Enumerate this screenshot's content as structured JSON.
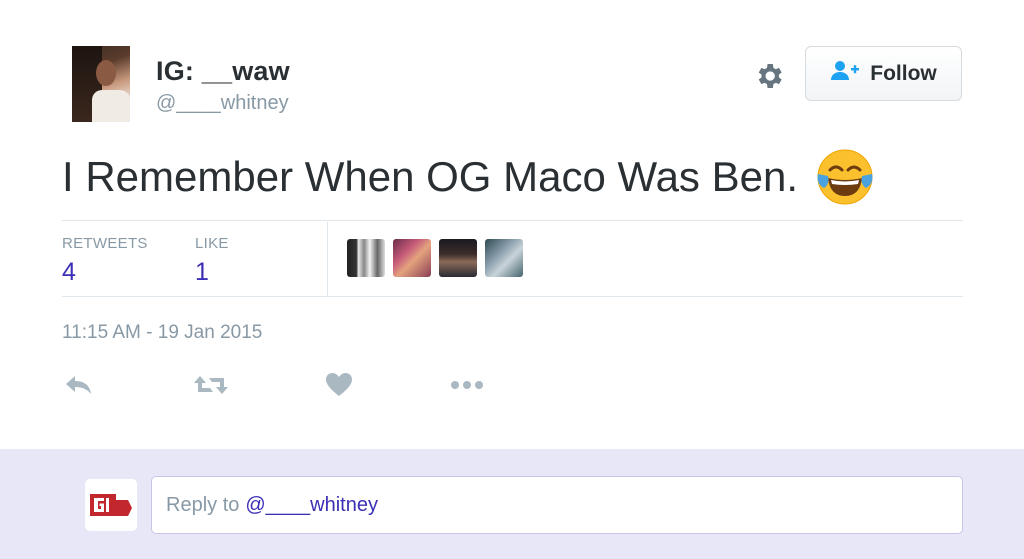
{
  "tweet": {
    "author": {
      "name": "IG: __waw",
      "handle": "@____whitney"
    },
    "follow_label": "Follow",
    "text": "I Remember When OG Maco Was Ben.",
    "emoji": "face-with-tears-of-joy",
    "stats": {
      "retweets_label": "RETWEETS",
      "retweets_value": "4",
      "likes_label": "LIKE",
      "likes_value": "1"
    },
    "timestamp": "11:15 AM - 19 Jan 2015"
  },
  "actions": [
    "reply-icon",
    "retweet-icon",
    "heart-icon",
    "more-icon"
  ],
  "reply": {
    "prefix": "Reply to",
    "mention": "@____whitney"
  },
  "colors": {
    "accent": "#3b2fb5",
    "muted": "#8899a6",
    "reply_bar": "#e8e7f7",
    "brand_red": "#c1272d"
  }
}
